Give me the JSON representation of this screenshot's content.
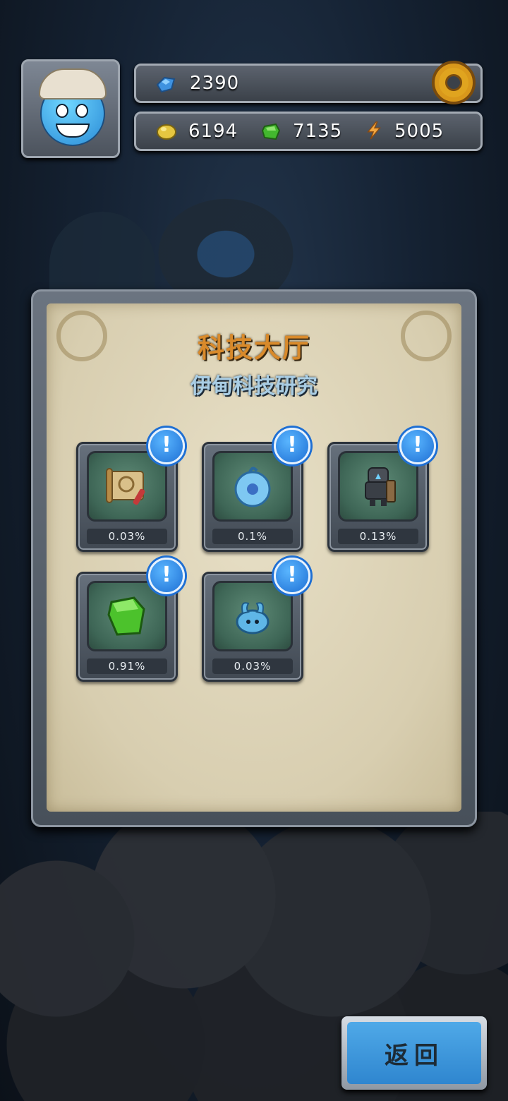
{
  "resources": {
    "crystal": "2390",
    "gold": "6194",
    "green_gem": "7135",
    "energy": "5005"
  },
  "panel": {
    "title": "科技大厅",
    "subtitle": "伊甸科技研究"
  },
  "tech_items": [
    {
      "name": "scroll-map",
      "percent": "0.03%",
      "badge": "!"
    },
    {
      "name": "blue-orb",
      "percent": "0.1%",
      "badge": "!"
    },
    {
      "name": "robot-armor",
      "percent": "0.13%",
      "badge": "!"
    },
    {
      "name": "green-crystal",
      "percent": "0.91%",
      "badge": "!"
    },
    {
      "name": "blue-creature",
      "percent": "0.03%",
      "badge": "!"
    }
  ],
  "buttons": {
    "back": "返回"
  },
  "colors": {
    "title": "#d98a2b",
    "subtitle": "#a9cde4",
    "badge": "#1e6fd4",
    "back_button": "#3a95dc"
  },
  "icons": {
    "settings": "gear-icon",
    "crystal": "blue-crystal-icon",
    "gold": "gold-nugget-icon",
    "green_gem": "green-gem-icon",
    "energy": "lightning-icon"
  }
}
